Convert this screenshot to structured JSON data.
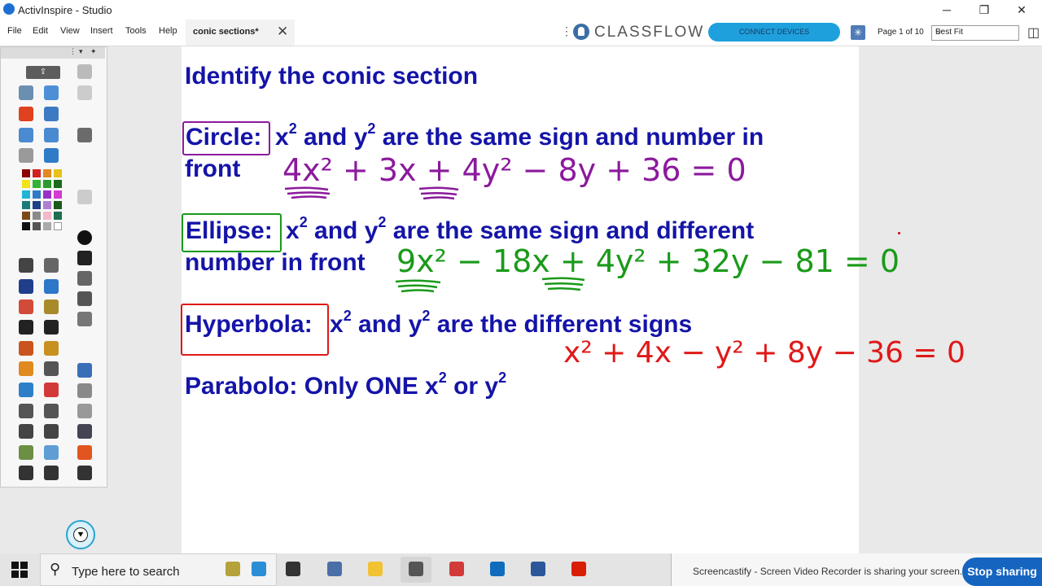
{
  "window": {
    "title": "ActivInspire - Studio",
    "minimize": "─",
    "restore": "❐",
    "close": "✕"
  },
  "menu": {
    "file": "File",
    "edit": "Edit",
    "view": "View",
    "insert": "Insert",
    "tools": "Tools",
    "help": "Help"
  },
  "document_tab": {
    "label": "conic sections*",
    "close": "✕"
  },
  "classflow": {
    "brand": "CLASSFLOW",
    "connect_label": "CONNECT DEVICES"
  },
  "page_info": "Page 1 of 10",
  "zoom_select": "Best Fit",
  "slide": {
    "title": "Identify the conic section",
    "circle": {
      "label": "Circle:",
      "rule_line1": "x² and y² are the same sign and number in",
      "rule_line2": "front",
      "example": "4x² + 3x + 4y² − 8y + 36 = 0"
    },
    "ellipse": {
      "label": "Ellipse:",
      "rule_line1": "x² and y² are the same sign and different",
      "rule_line2": "number in front",
      "example": "9x² − 18x + 4y² + 32y − 81 = 0"
    },
    "hyperbola": {
      "label": "Hyperbola:",
      "rule_line1": "x² and y² are the different signs",
      "example": "x² + 4x − y² + 8y − 36 = 0"
    },
    "parabola": {
      "rule_line1": "Parabolo: Only ONE x² or y²"
    }
  },
  "colors": {
    "title_text": "#1414a8",
    "circle": "#8b1a9c",
    "ellipse": "#1a9a1a",
    "hyperbola": "#e01818"
  },
  "taskbar": {
    "search_placeholder": "Type here to search"
  },
  "recorder": {
    "message": "Screencastify - Screen Video Recorder is sharing your screen.",
    "stop_label": "Stop sharing"
  }
}
